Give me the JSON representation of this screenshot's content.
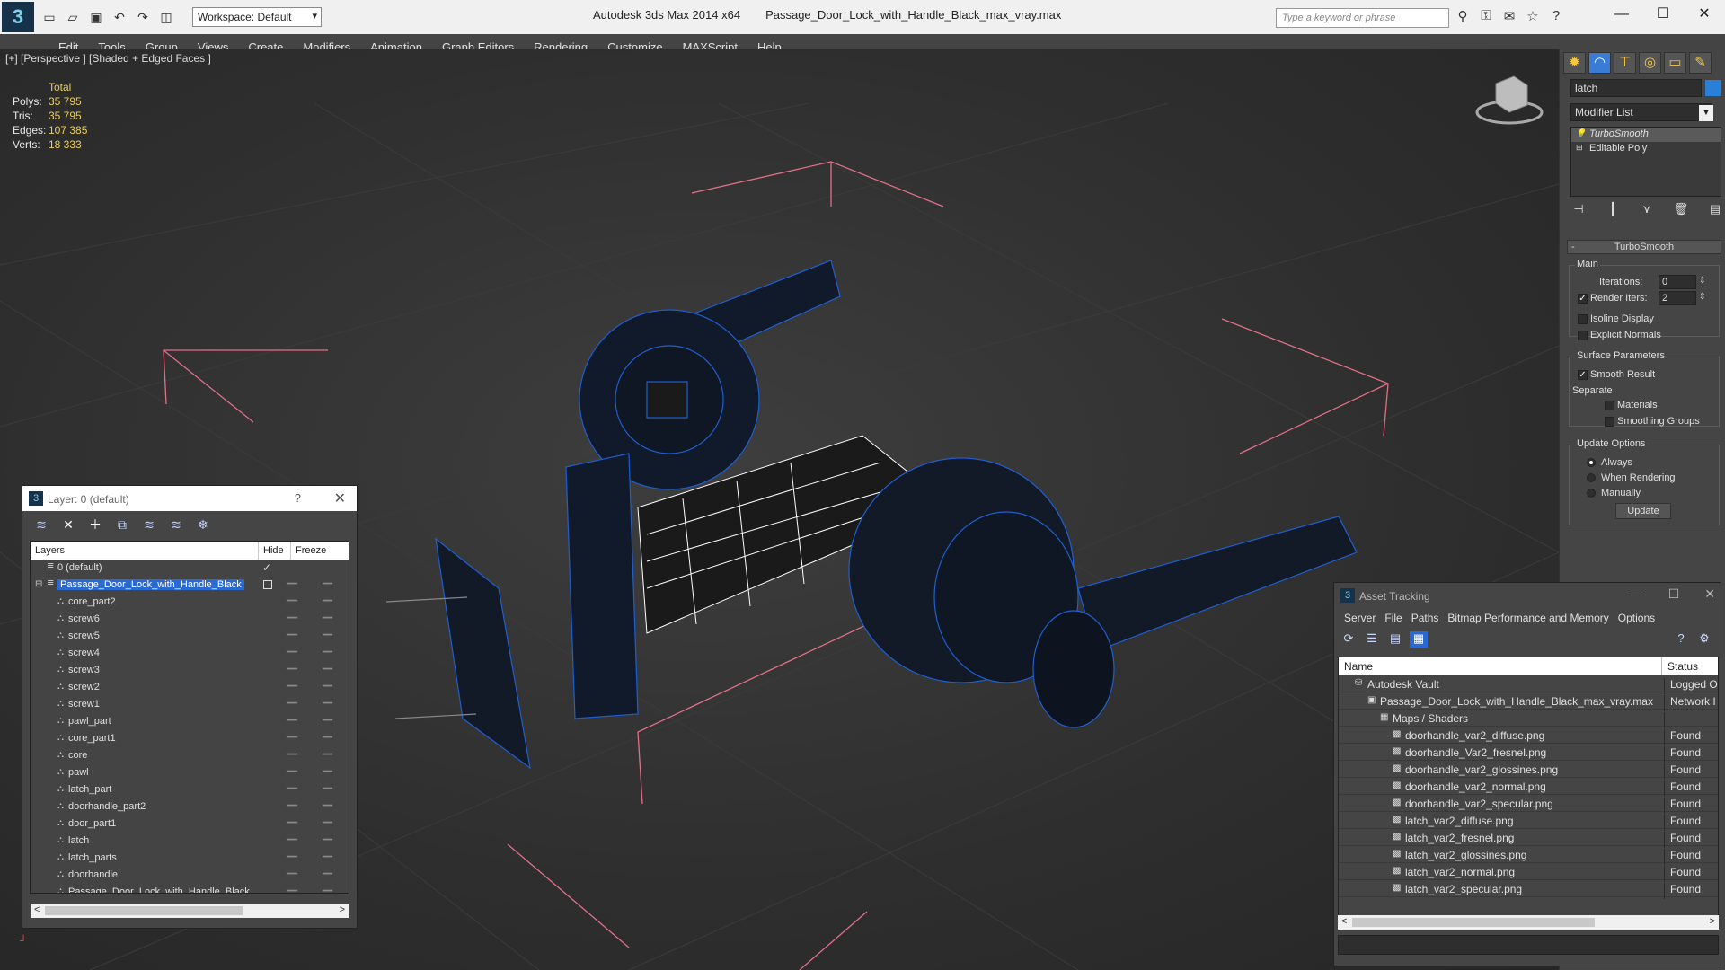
{
  "window": {
    "app_title": "Autodesk 3ds Max  2014 x64",
    "file_title": "Passage_Door_Lock_with_Handle_Black_max_vray.max",
    "workspace": "Workspace: Default",
    "search_placeholder": "Type a keyword or phrase"
  },
  "menu": [
    "Edit",
    "Tools",
    "Group",
    "Views",
    "Create",
    "Modifiers",
    "Animation",
    "Graph Editors",
    "Rendering",
    "Customize",
    "MAXScript",
    "Help"
  ],
  "viewport": {
    "label": "[+] [Perspective ] [Shaded + Edged Faces ]",
    "stats": {
      "header": "Total",
      "rows": [
        {
          "k": "Polys:",
          "v": "35 795"
        },
        {
          "k": "Tris:",
          "v": "35 795"
        },
        {
          "k": "Edges:",
          "v": "107 385"
        },
        {
          "k": "Verts:",
          "v": "18 333"
        }
      ]
    },
    "colors": {
      "wire_blue": "#1e5fd0",
      "bounds_pink": "#e0708a",
      "selected_white": "#ffffff"
    }
  },
  "command_panel": {
    "tab_icons": [
      "create-icon",
      "modify-icon",
      "hierarchy-icon",
      "motion-icon",
      "display-icon",
      "utilities-icon"
    ],
    "object_name": "latch",
    "object_color": "#2a7fd8",
    "modifier_list": "Modifier List",
    "stack": [
      "TurboSmooth",
      "Editable Poly"
    ],
    "rollout_title": "TurboSmooth",
    "main_label": "Main",
    "iterations_label": "Iterations:",
    "iterations_value": "0",
    "render_iters_label": "Render Iters:",
    "render_iters_value": "2",
    "isoline_label": "Isoline Display",
    "explicit_normals_label": "Explicit Normals",
    "surface_params_label": "Surface Parameters",
    "smooth_result_label": "Smooth Result",
    "separate_label": "Separate",
    "materials_label": "Materials",
    "smoothing_groups_label": "Smoothing Groups",
    "update_options_label": "Update Options",
    "always_label": "Always",
    "when_rendering_label": "When Rendering",
    "manually_label": "Manually",
    "update_button": "Update"
  },
  "layer_dialog": {
    "title": "Layer: 0 (default)",
    "help": "?",
    "columns": [
      "Layers",
      "Hide",
      "Freeze"
    ],
    "rows": [
      {
        "name": "0 (default)",
        "indent": 1,
        "type": "layer"
      },
      {
        "name": "Passage_Door_Lock_with_Handle_Black",
        "indent": 1,
        "type": "layer",
        "selected": true
      },
      {
        "name": "core_part2",
        "indent": 2,
        "type": "object"
      },
      {
        "name": "screw6",
        "indent": 2,
        "type": "object"
      },
      {
        "name": "screw5",
        "indent": 2,
        "type": "object"
      },
      {
        "name": "screw4",
        "indent": 2,
        "type": "object"
      },
      {
        "name": "screw3",
        "indent": 2,
        "type": "object"
      },
      {
        "name": "screw2",
        "indent": 2,
        "type": "object"
      },
      {
        "name": "screw1",
        "indent": 2,
        "type": "object"
      },
      {
        "name": "pawl_part",
        "indent": 2,
        "type": "object"
      },
      {
        "name": "core_part1",
        "indent": 2,
        "type": "object"
      },
      {
        "name": "core",
        "indent": 2,
        "type": "object"
      },
      {
        "name": "pawl",
        "indent": 2,
        "type": "object"
      },
      {
        "name": "latch_part",
        "indent": 2,
        "type": "object"
      },
      {
        "name": "doorhandle_part2",
        "indent": 2,
        "type": "object"
      },
      {
        "name": "door_part1",
        "indent": 2,
        "type": "object"
      },
      {
        "name": "latch",
        "indent": 2,
        "type": "object"
      },
      {
        "name": "latch_parts",
        "indent": 2,
        "type": "object"
      },
      {
        "name": "doorhandle",
        "indent": 2,
        "type": "object"
      },
      {
        "name": "Passage_Door_Lock_with_Handle_Black",
        "indent": 2,
        "type": "object"
      }
    ]
  },
  "asset_tracking": {
    "title": "Asset Tracking",
    "menu": [
      "Server",
      "File",
      "Paths",
      "Bitmap Performance and Memory",
      "Options"
    ],
    "columns": [
      "Name",
      "Status"
    ],
    "rows": [
      {
        "name": "Autodesk Vault",
        "status": "Logged O",
        "indent": 1
      },
      {
        "name": "Passage_Door_Lock_with_Handle_Black_max_vray.max",
        "status": "Network I",
        "indent": 2
      },
      {
        "name": "Maps / Shaders",
        "status": "",
        "indent": 3
      },
      {
        "name": "doorhandle_var2_diffuse.png",
        "status": "Found",
        "indent": 4
      },
      {
        "name": "doorhandle_Var2_fresnel.png",
        "status": "Found",
        "indent": 4
      },
      {
        "name": "doorhandle_var2_glossines.png",
        "status": "Found",
        "indent": 4
      },
      {
        "name": "doorhandle_var2_normal.png",
        "status": "Found",
        "indent": 4
      },
      {
        "name": "doorhandle_var2_specular.png",
        "status": "Found",
        "indent": 4
      },
      {
        "name": "latch_var2_diffuse.png",
        "status": "Found",
        "indent": 4
      },
      {
        "name": "latch_var2_fresnel.png",
        "status": "Found",
        "indent": 4
      },
      {
        "name": "latch_var2_glossines.png",
        "status": "Found",
        "indent": 4
      },
      {
        "name": "latch_var2_normal.png",
        "status": "Found",
        "indent": 4
      },
      {
        "name": "latch_var2_specular.png",
        "status": "Found",
        "indent": 4
      }
    ]
  }
}
